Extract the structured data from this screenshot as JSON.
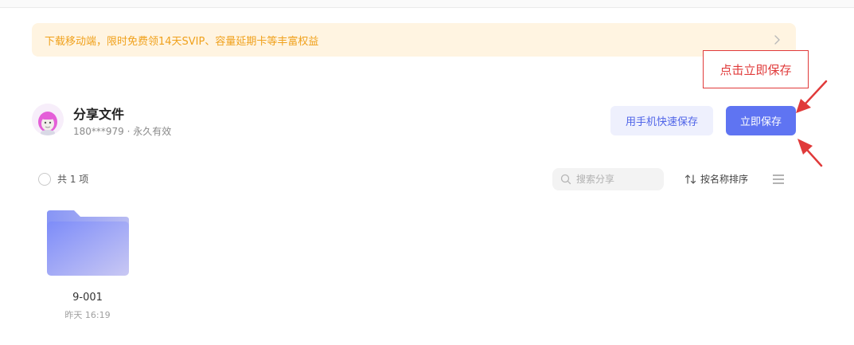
{
  "promo": {
    "text": "下载移动端，限时免费领14天SVIP、容量延期卡等丰富权益",
    "color": "#f0a11c",
    "background": "#fff4e1"
  },
  "annotation": {
    "text": "点击立即保存",
    "color": "#e03a3a"
  },
  "share": {
    "title": "分享文件",
    "meta": "180***979 · 永久有效"
  },
  "buttons": {
    "phone_save": "用手机快速保存",
    "save_now": "立即保存",
    "accent": "#5f74f2"
  },
  "list_header": {
    "count": "共 1 项",
    "search_placeholder": "搜索分享",
    "sort_label": "按名称排序"
  },
  "files": [
    {
      "name": "9-001",
      "time": "昨天 16:19",
      "icon": "folder-icon"
    }
  ],
  "icons": {
    "promo": "chevron-right-icon",
    "search": "search-icon",
    "sort": "sort-icon",
    "view": "list-view-icon",
    "avatar": "avatar"
  }
}
